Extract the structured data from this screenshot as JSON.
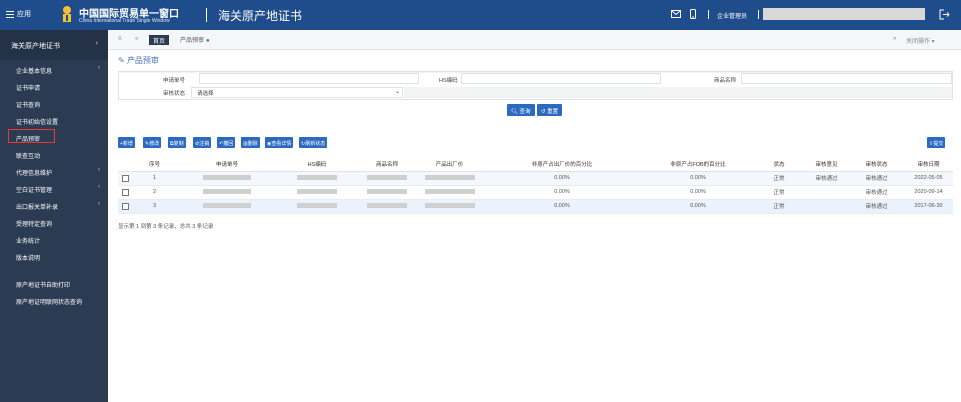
{
  "topbar": {
    "menu_label": "应用",
    "brand_cn": "中国国际贸易单一窗口",
    "brand_en": "China International Trade Single Window",
    "system_title": "海关原产地证书",
    "user_label": "企业管理员"
  },
  "sidebar": {
    "header": "海关原产地证书",
    "items": [
      {
        "label": "企业基本信息",
        "has_arrow": true
      },
      {
        "label": "证书申请",
        "has_arrow": false
      },
      {
        "label": "证书查询",
        "has_arrow": false
      },
      {
        "label": "证书初始信设置",
        "has_arrow": false
      },
      {
        "label": "产品预审",
        "has_arrow": false,
        "active": true
      },
      {
        "label": "联查互动",
        "has_arrow": false
      },
      {
        "label": "代理信息维护",
        "has_arrow": true
      },
      {
        "label": "空白证书管理",
        "has_arrow": true
      },
      {
        "label": "出口报关单补录",
        "has_arrow": true
      },
      {
        "label": "受理特定查询",
        "has_arrow": false
      },
      {
        "label": "业务统计",
        "has_arrow": false
      },
      {
        "label": "版本说明",
        "has_arrow": false
      }
    ],
    "extra_items": [
      {
        "label": "原产地证书自助打印"
      },
      {
        "label": "原产地证明联网状态查询"
      }
    ]
  },
  "tabbar": {
    "home_tab": "首页",
    "active_tab": "产品预审",
    "close_ops": "关闭操作"
  },
  "page_title": "产品预审",
  "search": {
    "apply_no_label": "申请单号",
    "hs_label": "HS编码",
    "product_label": "商品名称",
    "status_label": "审核状态",
    "status_value": "请选择",
    "query_button": "查询",
    "reset_button": "重置"
  },
  "toolbar": {
    "buttons": [
      "新增",
      "修改",
      "复制",
      "注销",
      "撤回",
      "删除",
      "查看详情",
      "刷新状态"
    ],
    "submit_button": "提交"
  },
  "table": {
    "headers": [
      "序号",
      "申请单号",
      "HS编码",
      "商品名称",
      "产品出厂价",
      "非原产占出厂价的百分比",
      "非原产占FOB的百分比",
      "状态",
      "审核意见",
      "审核状态",
      "审核日期"
    ],
    "rows": [
      {
        "no": "1",
        "pct_factory": "0.00%",
        "pct_fob": "0.00%",
        "status": "正常",
        "opinion": "审核通过",
        "review_status": "审核通过",
        "date": "2022-05-05"
      },
      {
        "no": "2",
        "pct_factory": "0.00%",
        "pct_fob": "0.00%",
        "status": "正常",
        "opinion": "",
        "review_status": "审核通过",
        "date": "2020-09-14"
      },
      {
        "no": "3",
        "pct_factory": "0.00%",
        "pct_fob": "0.00%",
        "status": "正常",
        "opinion": "",
        "review_status": "审核通过",
        "date": "2017-06-30"
      }
    ]
  },
  "pager_text": "显示第 1 到第 3 条记录，总共 3 条记录",
  "icons": {
    "mail": "mail-icon",
    "phone": "phone-icon",
    "logout": "logout-icon",
    "edit": "edit-icon"
  },
  "colors": {
    "topbar": "#1f4d8c",
    "sidebar": "#2b3b52",
    "primary": "#2c6ac2",
    "active_highlight": "#e53935"
  }
}
